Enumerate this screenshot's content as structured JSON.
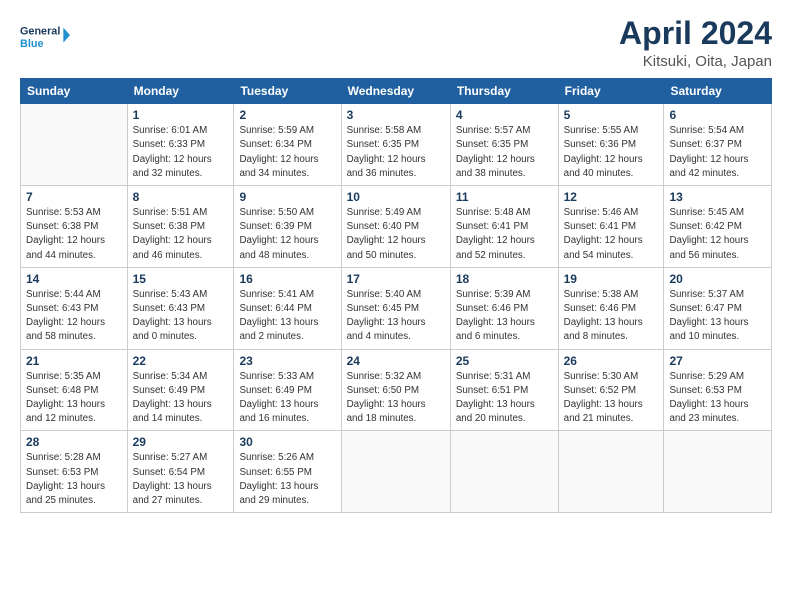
{
  "header": {
    "logo_line1": "General",
    "logo_line2": "Blue",
    "month_title": "April 2024",
    "location": "Kitsuki, Oita, Japan"
  },
  "weekdays": [
    "Sunday",
    "Monday",
    "Tuesday",
    "Wednesday",
    "Thursday",
    "Friday",
    "Saturday"
  ],
  "days": [
    {
      "date": "",
      "info": ""
    },
    {
      "date": "1",
      "info": "Sunrise: 6:01 AM\nSunset: 6:33 PM\nDaylight: 12 hours\nand 32 minutes."
    },
    {
      "date": "2",
      "info": "Sunrise: 5:59 AM\nSunset: 6:34 PM\nDaylight: 12 hours\nand 34 minutes."
    },
    {
      "date": "3",
      "info": "Sunrise: 5:58 AM\nSunset: 6:35 PM\nDaylight: 12 hours\nand 36 minutes."
    },
    {
      "date": "4",
      "info": "Sunrise: 5:57 AM\nSunset: 6:35 PM\nDaylight: 12 hours\nand 38 minutes."
    },
    {
      "date": "5",
      "info": "Sunrise: 5:55 AM\nSunset: 6:36 PM\nDaylight: 12 hours\nand 40 minutes."
    },
    {
      "date": "6",
      "info": "Sunrise: 5:54 AM\nSunset: 6:37 PM\nDaylight: 12 hours\nand 42 minutes."
    },
    {
      "date": "7",
      "info": "Sunrise: 5:53 AM\nSunset: 6:38 PM\nDaylight: 12 hours\nand 44 minutes."
    },
    {
      "date": "8",
      "info": "Sunrise: 5:51 AM\nSunset: 6:38 PM\nDaylight: 12 hours\nand 46 minutes."
    },
    {
      "date": "9",
      "info": "Sunrise: 5:50 AM\nSunset: 6:39 PM\nDaylight: 12 hours\nand 48 minutes."
    },
    {
      "date": "10",
      "info": "Sunrise: 5:49 AM\nSunset: 6:40 PM\nDaylight: 12 hours\nand 50 minutes."
    },
    {
      "date": "11",
      "info": "Sunrise: 5:48 AM\nSunset: 6:41 PM\nDaylight: 12 hours\nand 52 minutes."
    },
    {
      "date": "12",
      "info": "Sunrise: 5:46 AM\nSunset: 6:41 PM\nDaylight: 12 hours\nand 54 minutes."
    },
    {
      "date": "13",
      "info": "Sunrise: 5:45 AM\nSunset: 6:42 PM\nDaylight: 12 hours\nand 56 minutes."
    },
    {
      "date": "14",
      "info": "Sunrise: 5:44 AM\nSunset: 6:43 PM\nDaylight: 12 hours\nand 58 minutes."
    },
    {
      "date": "15",
      "info": "Sunrise: 5:43 AM\nSunset: 6:43 PM\nDaylight: 13 hours\nand 0 minutes."
    },
    {
      "date": "16",
      "info": "Sunrise: 5:41 AM\nSunset: 6:44 PM\nDaylight: 13 hours\nand 2 minutes."
    },
    {
      "date": "17",
      "info": "Sunrise: 5:40 AM\nSunset: 6:45 PM\nDaylight: 13 hours\nand 4 minutes."
    },
    {
      "date": "18",
      "info": "Sunrise: 5:39 AM\nSunset: 6:46 PM\nDaylight: 13 hours\nand 6 minutes."
    },
    {
      "date": "19",
      "info": "Sunrise: 5:38 AM\nSunset: 6:46 PM\nDaylight: 13 hours\nand 8 minutes."
    },
    {
      "date": "20",
      "info": "Sunrise: 5:37 AM\nSunset: 6:47 PM\nDaylight: 13 hours\nand 10 minutes."
    },
    {
      "date": "21",
      "info": "Sunrise: 5:35 AM\nSunset: 6:48 PM\nDaylight: 13 hours\nand 12 minutes."
    },
    {
      "date": "22",
      "info": "Sunrise: 5:34 AM\nSunset: 6:49 PM\nDaylight: 13 hours\nand 14 minutes."
    },
    {
      "date": "23",
      "info": "Sunrise: 5:33 AM\nSunset: 6:49 PM\nDaylight: 13 hours\nand 16 minutes."
    },
    {
      "date": "24",
      "info": "Sunrise: 5:32 AM\nSunset: 6:50 PM\nDaylight: 13 hours\nand 18 minutes."
    },
    {
      "date": "25",
      "info": "Sunrise: 5:31 AM\nSunset: 6:51 PM\nDaylight: 13 hours\nand 20 minutes."
    },
    {
      "date": "26",
      "info": "Sunrise: 5:30 AM\nSunset: 6:52 PM\nDaylight: 13 hours\nand 21 minutes."
    },
    {
      "date": "27",
      "info": "Sunrise: 5:29 AM\nSunset: 6:53 PM\nDaylight: 13 hours\nand 23 minutes."
    },
    {
      "date": "28",
      "info": "Sunrise: 5:28 AM\nSunset: 6:53 PM\nDaylight: 13 hours\nand 25 minutes."
    },
    {
      "date": "29",
      "info": "Sunrise: 5:27 AM\nSunset: 6:54 PM\nDaylight: 13 hours\nand 27 minutes."
    },
    {
      "date": "30",
      "info": "Sunrise: 5:26 AM\nSunset: 6:55 PM\nDaylight: 13 hours\nand 29 minutes."
    },
    {
      "date": "",
      "info": ""
    },
    {
      "date": "",
      "info": ""
    },
    {
      "date": "",
      "info": ""
    },
    {
      "date": "",
      "info": ""
    }
  ]
}
